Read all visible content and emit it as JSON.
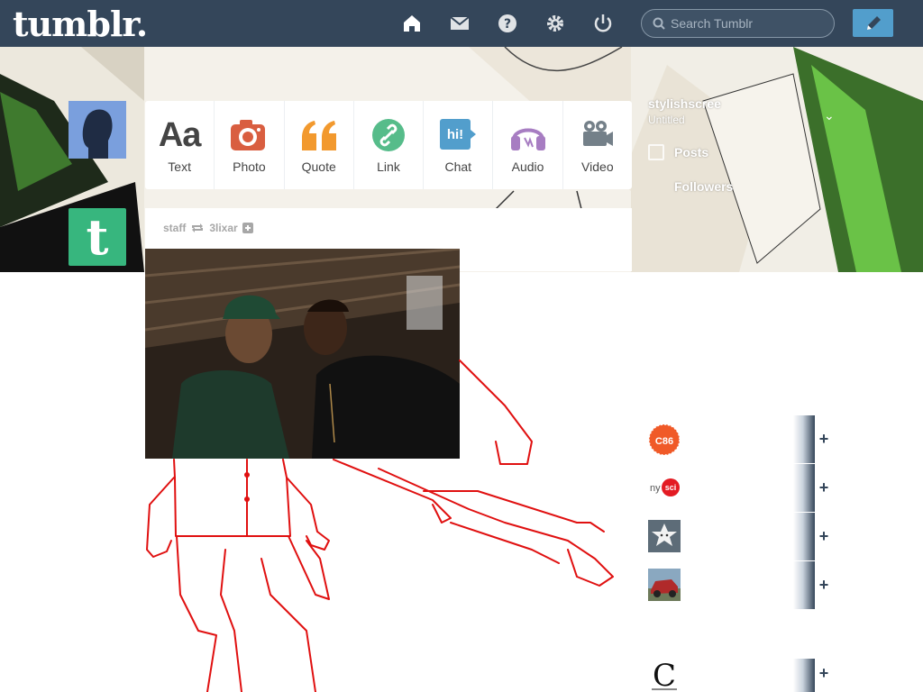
{
  "header": {
    "logo": "tumblr.",
    "search_placeholder": "Search Tumblr",
    "icons": [
      "home-icon",
      "mail-icon",
      "help-icon",
      "gear-icon",
      "power-icon"
    ],
    "compose_icon": "pencil-icon",
    "bg_color": "#34465a"
  },
  "post_types": [
    {
      "label": "Text",
      "icon": "text-aa-icon",
      "color": "#444444"
    },
    {
      "label": "Photo",
      "icon": "camera-icon",
      "color": "#d95e40"
    },
    {
      "label": "Quote",
      "icon": "quote-icon",
      "color": "#f2992e"
    },
    {
      "label": "Link",
      "icon": "link-icon",
      "color": "#56bc8a"
    },
    {
      "label": "Chat",
      "icon": "chat-hi-icon",
      "color": "#529ecc"
    },
    {
      "label": "Audio",
      "icon": "headphones-icon",
      "color": "#a77dc2"
    },
    {
      "label": "Video",
      "icon": "video-camera-icon",
      "color": "#748089"
    }
  ],
  "post": {
    "author": "staff",
    "reblog_icon": "reblog-icon",
    "source": "3lixar",
    "follow_icon": "plus-square-icon"
  },
  "account": {
    "name": "stylishscree",
    "subtitle": "Untitled",
    "posts_label": "Posts",
    "followers_label": "Followers"
  },
  "recommended": [
    {
      "avatar_text": "C86",
      "avatar_icon": "c86-badge-icon",
      "plus": "+"
    },
    {
      "avatar_text": "nysci",
      "avatar_icon": "nysci-logo-icon",
      "plus": "+"
    },
    {
      "avatar_text": "",
      "avatar_icon": "star-face-icon",
      "plus": "+"
    },
    {
      "avatar_text": "",
      "avatar_icon": "car-photo-icon",
      "plus": "+"
    },
    {
      "avatar_text": "C",
      "avatar_icon": "c-logo-icon",
      "plus": "+"
    }
  ]
}
